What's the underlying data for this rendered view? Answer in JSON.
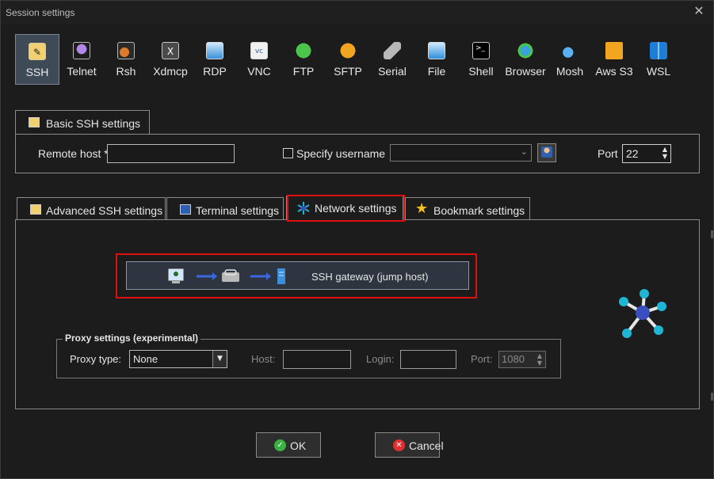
{
  "window": {
    "title": "Session settings",
    "close_glyph": "✕"
  },
  "protocols": [
    {
      "label": "SSH",
      "icon": "key-icon",
      "active": true
    },
    {
      "label": "Telnet",
      "icon": "gem-icon"
    },
    {
      "label": "Rsh",
      "icon": "gears-icon"
    },
    {
      "label": "Xdmcp",
      "icon": "x-display-icon"
    },
    {
      "label": "RDP",
      "icon": "remote-desktop-icon"
    },
    {
      "label": "VNC",
      "icon": "vnc-icon"
    },
    {
      "label": "FTP",
      "icon": "ftp-globe-icon"
    },
    {
      "label": "SFTP",
      "icon": "sftp-globe-icon"
    },
    {
      "label": "Serial",
      "icon": "serial-plug-icon"
    },
    {
      "label": "File",
      "icon": "file-monitor-icon"
    },
    {
      "label": "Shell",
      "icon": "terminal-icon"
    },
    {
      "label": "Browser",
      "icon": "browser-globe-icon"
    },
    {
      "label": "Mosh",
      "icon": "satellite-icon"
    },
    {
      "label": "Aws S3",
      "icon": "aws-cubes-icon"
    },
    {
      "label": "WSL",
      "icon": "windows-icon"
    }
  ],
  "basic": {
    "tab_label": "Basic SSH settings",
    "remote_host_label": "Remote host *",
    "remote_host_value": "",
    "specify_username_label": "Specify username",
    "specify_username_checked": false,
    "username_value": "",
    "port_label": "Port",
    "port_value": "22"
  },
  "tabs": [
    {
      "label": "Advanced SSH settings",
      "icon": "key-icon"
    },
    {
      "label": "Terminal settings",
      "icon": "terminal-settings-icon"
    },
    {
      "label": "Network settings",
      "icon": "network-star-icon",
      "active": true
    },
    {
      "label": "Bookmark settings",
      "icon": "star-icon"
    }
  ],
  "network": {
    "gateway_label": "SSH gateway (jump host)",
    "proxy_title": "Proxy settings (experimental)",
    "proxy_type_label": "Proxy type:",
    "proxy_type_value": "None",
    "host_label": "Host:",
    "host_value": "",
    "login_label": "Login:",
    "login_value": "",
    "port_label": "Port:",
    "port_value": "1080"
  },
  "buttons": {
    "ok": "OK",
    "cancel": "Cancel"
  },
  "colors": {
    "background": "#1c1c1c",
    "highlight": "#e01010",
    "ok_icon": "#3cb043",
    "cancel_icon": "#e03030",
    "network_graphic": "#1fb6d6",
    "network_center": "#3a4fbf"
  }
}
